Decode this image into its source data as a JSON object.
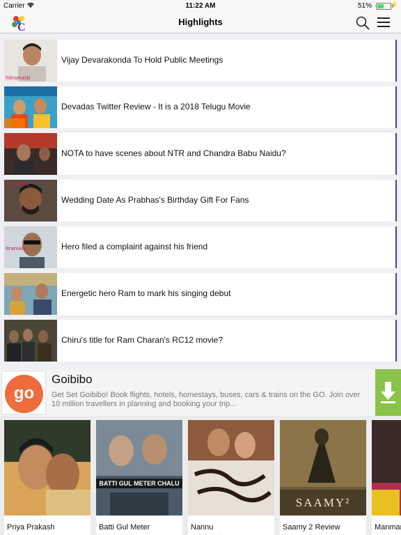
{
  "status_bar": {
    "carrier": "Carrier",
    "time": "11:22 AM",
    "battery": "51%",
    "battery_level": 0.51
  },
  "nav": {
    "title": "Highlights"
  },
  "articles": [
    {
      "title": "Vijay Devarakonda To Hold Public Meetings",
      "thumb_label": "hitramalal"
    },
    {
      "title": "Devadas Twitter Review - It is a 2018 Telugu Movie",
      "thumb_label": ""
    },
    {
      "title": "NOTA to have scenes about NTR and Chandra Babu Naidu?",
      "thumb_label": ""
    },
    {
      "title": "Wedding Date As Prabhas's Birthday Gift For Fans",
      "thumb_label": "hitramala"
    },
    {
      "title": "Hero filed a complaint against his friend",
      "thumb_label": "itramala"
    },
    {
      "title": "Energetic hero Ram to mark his singing debut",
      "thumb_label": ""
    },
    {
      "title": "Chiru's title for Ram Charan's RC12 movie?",
      "thumb_label": ""
    }
  ],
  "ad": {
    "logo_text": "go",
    "title": "Goibibo",
    "description": "Get Set Goibibo! Book flights, hotels, homestays, buses, cars & trains on the GO. Join over 10 million travellers in planning and booking your trip..."
  },
  "movies": [
    {
      "name": "Priya Prakash",
      "poster_text": ""
    },
    {
      "name": "Batti Gul Meter",
      "poster_text": "BATTI GUL METER CHALU"
    },
    {
      "name": "Nannu",
      "poster_text": ""
    },
    {
      "name": "Saamy 2 Review",
      "poster_text": "SAAMY²"
    },
    {
      "name": "Manmar",
      "poster_text": ""
    }
  ],
  "colors": {
    "accent": "#4a3f8c",
    "goibibo": "#ef6c3e",
    "download": "#8bc34a"
  }
}
